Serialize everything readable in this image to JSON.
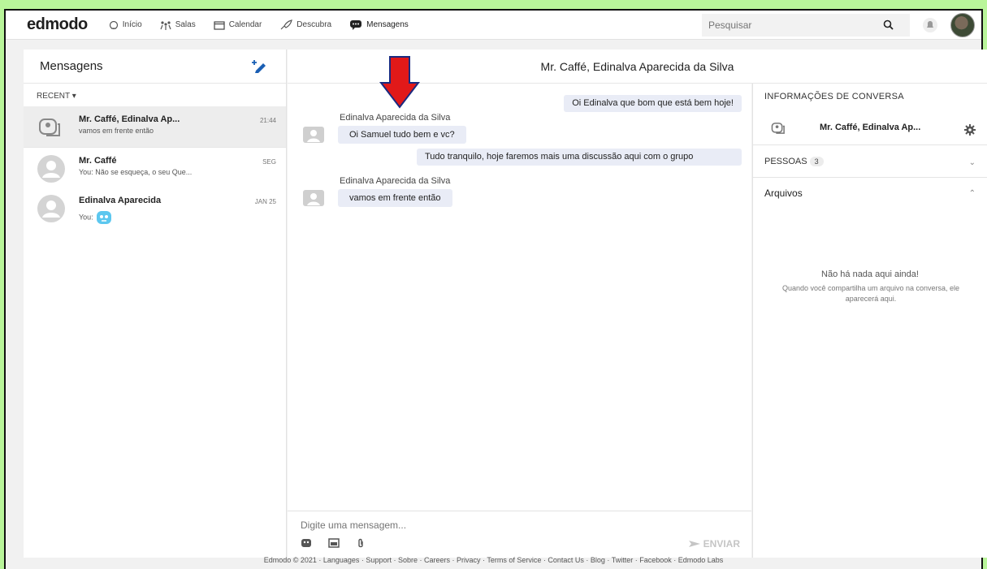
{
  "nav": {
    "logo": "edmodo",
    "items": [
      {
        "label": "Início",
        "icon": "home-icon"
      },
      {
        "label": "Salas",
        "icon": "classes-icon"
      },
      {
        "label": "Calendar",
        "icon": "calendar-icon"
      },
      {
        "label": "Descubra",
        "icon": "discover-icon"
      },
      {
        "label": "Mensagens",
        "icon": "messages-icon"
      }
    ],
    "search_placeholder": "Pesquisar"
  },
  "sidebar": {
    "title": "Mensagens",
    "filter": "RECENT ▾",
    "conversations": [
      {
        "name": "Mr. Caffé, Edinalva Ap...",
        "snippet": "vamos em frente então",
        "time": "21:44"
      },
      {
        "name": "Mr. Caffé",
        "snippet": "You: Não se esqueça, o seu Que...",
        "time": "SEG"
      },
      {
        "name": "Edinalva Aparecida",
        "snippet": "You:",
        "time": "JAN 25"
      }
    ]
  },
  "conversation": {
    "title": "Mr. Caffé, Edinalva Aparecida da Silva",
    "messages": [
      {
        "text": "Oi Edinalva que bom que está bem hoje!"
      },
      {
        "sender": "Edinalva Aparecida da Silva",
        "text": "Oi Samuel tudo bem e vc?"
      },
      {
        "text": "Tudo tranquilo, hoje faremos mais uma discussão aqui com o grupo"
      },
      {
        "sender": "Edinalva Aparecida da Silva",
        "text": "vamos em frente então"
      }
    ],
    "composer_placeholder": "Digite uma mensagem...",
    "send_label": "ENVIAR"
  },
  "info": {
    "title": "INFORMAÇÕES DE CONVERSA",
    "conv_name": "Mr. Caffé, Edinalva Ap...",
    "people_label": "PESSOAS",
    "people_count": "3",
    "files_label": "Arquivos",
    "empty_title": "Não há nada aqui ainda!",
    "empty_desc": "Quando você compartilha um arquivo na conversa, ele aparecerá aqui."
  },
  "footer": "Edmodo © 2021 · Languages · Support · Sobre · Careers · Privacy · Terms of Service · Contact Us · Blog · Twitter · Facebook · Edmodo Labs",
  "colors": {
    "outer_bg": "#b9f59a",
    "bubble": "#e9ecf6",
    "arrow": "#e11919",
    "compose_icon": "#1a5fb4"
  }
}
